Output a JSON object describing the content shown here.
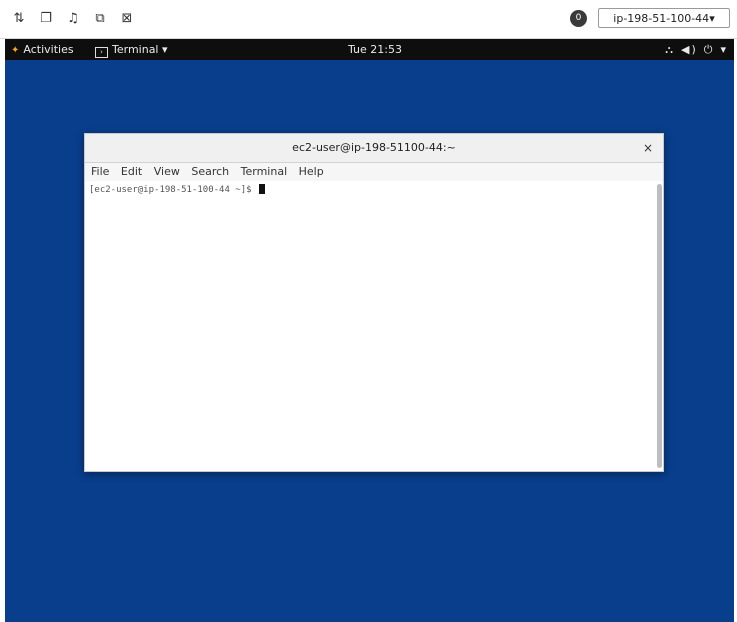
{
  "toolbar": {
    "icons": [
      "ctrl-alt-del-icon",
      "window-icon",
      "audio-icon",
      "copy-icon",
      "fullscreen-icon"
    ],
    "badge": "0",
    "host": "ip-198-51-100-44"
  },
  "topbar": {
    "activities": "Activities",
    "app": "Terminal",
    "clock": "Tue 21:53"
  },
  "terminal": {
    "title": "ec2-user@ip-198-51100-44:~",
    "menu": [
      "File",
      "Edit",
      "View",
      "Search",
      "Terminal",
      "Help"
    ],
    "prompt": "[ec2-user@ip-198-51-100-44 ~]$ "
  },
  "colors": {
    "desktop": "#083e8c",
    "topbar": "#0e0e0e"
  }
}
